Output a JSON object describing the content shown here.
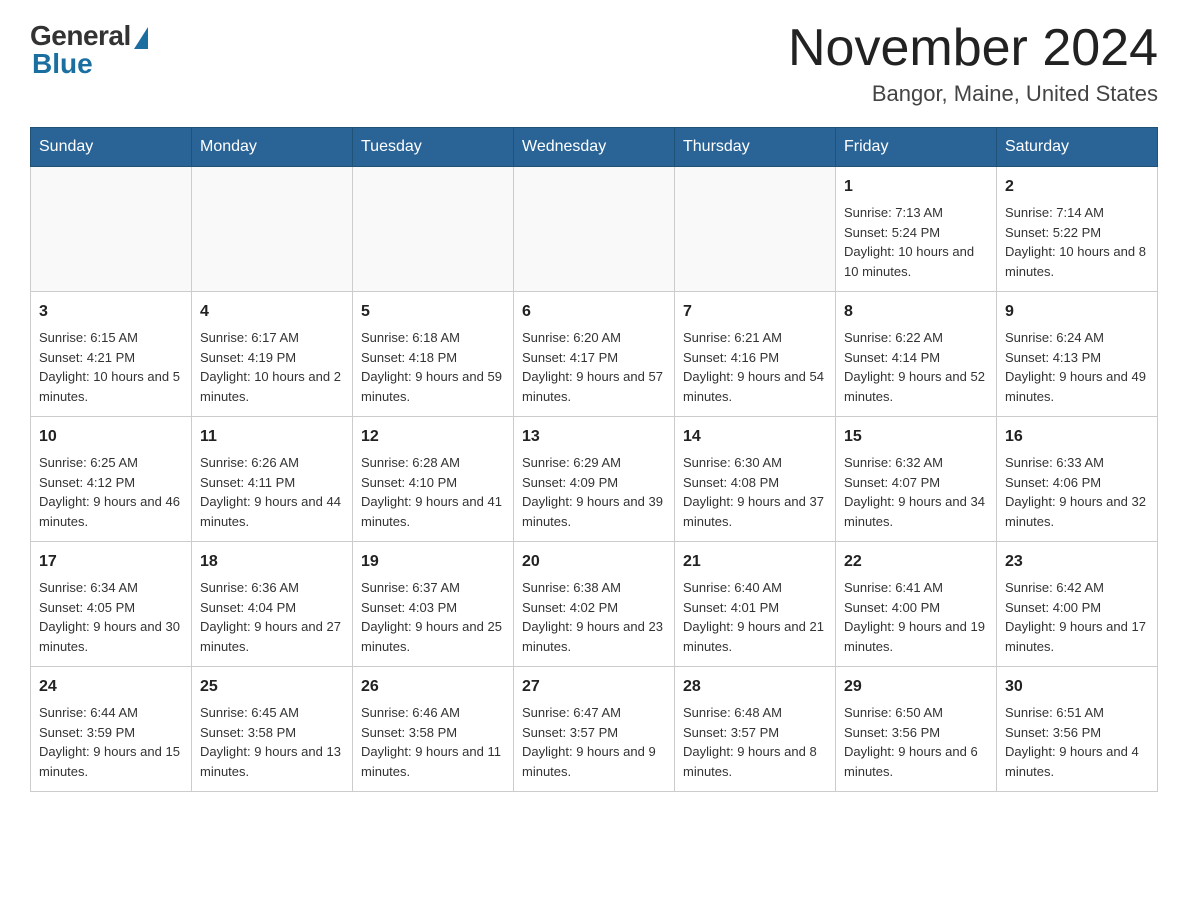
{
  "header": {
    "logo_general": "General",
    "logo_blue": "Blue",
    "month_title": "November 2024",
    "location": "Bangor, Maine, United States"
  },
  "weekdays": [
    "Sunday",
    "Monday",
    "Tuesday",
    "Wednesday",
    "Thursday",
    "Friday",
    "Saturday"
  ],
  "weeks": [
    [
      {
        "day": "",
        "sunrise": "",
        "sunset": "",
        "daylight": ""
      },
      {
        "day": "",
        "sunrise": "",
        "sunset": "",
        "daylight": ""
      },
      {
        "day": "",
        "sunrise": "",
        "sunset": "",
        "daylight": ""
      },
      {
        "day": "",
        "sunrise": "",
        "sunset": "",
        "daylight": ""
      },
      {
        "day": "",
        "sunrise": "",
        "sunset": "",
        "daylight": ""
      },
      {
        "day": "1",
        "sunrise": "Sunrise: 7:13 AM",
        "sunset": "Sunset: 5:24 PM",
        "daylight": "Daylight: 10 hours and 10 minutes."
      },
      {
        "day": "2",
        "sunrise": "Sunrise: 7:14 AM",
        "sunset": "Sunset: 5:22 PM",
        "daylight": "Daylight: 10 hours and 8 minutes."
      }
    ],
    [
      {
        "day": "3",
        "sunrise": "Sunrise: 6:15 AM",
        "sunset": "Sunset: 4:21 PM",
        "daylight": "Daylight: 10 hours and 5 minutes."
      },
      {
        "day": "4",
        "sunrise": "Sunrise: 6:17 AM",
        "sunset": "Sunset: 4:19 PM",
        "daylight": "Daylight: 10 hours and 2 minutes."
      },
      {
        "day": "5",
        "sunrise": "Sunrise: 6:18 AM",
        "sunset": "Sunset: 4:18 PM",
        "daylight": "Daylight: 9 hours and 59 minutes."
      },
      {
        "day": "6",
        "sunrise": "Sunrise: 6:20 AM",
        "sunset": "Sunset: 4:17 PM",
        "daylight": "Daylight: 9 hours and 57 minutes."
      },
      {
        "day": "7",
        "sunrise": "Sunrise: 6:21 AM",
        "sunset": "Sunset: 4:16 PM",
        "daylight": "Daylight: 9 hours and 54 minutes."
      },
      {
        "day": "8",
        "sunrise": "Sunrise: 6:22 AM",
        "sunset": "Sunset: 4:14 PM",
        "daylight": "Daylight: 9 hours and 52 minutes."
      },
      {
        "day": "9",
        "sunrise": "Sunrise: 6:24 AM",
        "sunset": "Sunset: 4:13 PM",
        "daylight": "Daylight: 9 hours and 49 minutes."
      }
    ],
    [
      {
        "day": "10",
        "sunrise": "Sunrise: 6:25 AM",
        "sunset": "Sunset: 4:12 PM",
        "daylight": "Daylight: 9 hours and 46 minutes."
      },
      {
        "day": "11",
        "sunrise": "Sunrise: 6:26 AM",
        "sunset": "Sunset: 4:11 PM",
        "daylight": "Daylight: 9 hours and 44 minutes."
      },
      {
        "day": "12",
        "sunrise": "Sunrise: 6:28 AM",
        "sunset": "Sunset: 4:10 PM",
        "daylight": "Daylight: 9 hours and 41 minutes."
      },
      {
        "day": "13",
        "sunrise": "Sunrise: 6:29 AM",
        "sunset": "Sunset: 4:09 PM",
        "daylight": "Daylight: 9 hours and 39 minutes."
      },
      {
        "day": "14",
        "sunrise": "Sunrise: 6:30 AM",
        "sunset": "Sunset: 4:08 PM",
        "daylight": "Daylight: 9 hours and 37 minutes."
      },
      {
        "day": "15",
        "sunrise": "Sunrise: 6:32 AM",
        "sunset": "Sunset: 4:07 PM",
        "daylight": "Daylight: 9 hours and 34 minutes."
      },
      {
        "day": "16",
        "sunrise": "Sunrise: 6:33 AM",
        "sunset": "Sunset: 4:06 PM",
        "daylight": "Daylight: 9 hours and 32 minutes."
      }
    ],
    [
      {
        "day": "17",
        "sunrise": "Sunrise: 6:34 AM",
        "sunset": "Sunset: 4:05 PM",
        "daylight": "Daylight: 9 hours and 30 minutes."
      },
      {
        "day": "18",
        "sunrise": "Sunrise: 6:36 AM",
        "sunset": "Sunset: 4:04 PM",
        "daylight": "Daylight: 9 hours and 27 minutes."
      },
      {
        "day": "19",
        "sunrise": "Sunrise: 6:37 AM",
        "sunset": "Sunset: 4:03 PM",
        "daylight": "Daylight: 9 hours and 25 minutes."
      },
      {
        "day": "20",
        "sunrise": "Sunrise: 6:38 AM",
        "sunset": "Sunset: 4:02 PM",
        "daylight": "Daylight: 9 hours and 23 minutes."
      },
      {
        "day": "21",
        "sunrise": "Sunrise: 6:40 AM",
        "sunset": "Sunset: 4:01 PM",
        "daylight": "Daylight: 9 hours and 21 minutes."
      },
      {
        "day": "22",
        "sunrise": "Sunrise: 6:41 AM",
        "sunset": "Sunset: 4:00 PM",
        "daylight": "Daylight: 9 hours and 19 minutes."
      },
      {
        "day": "23",
        "sunrise": "Sunrise: 6:42 AM",
        "sunset": "Sunset: 4:00 PM",
        "daylight": "Daylight: 9 hours and 17 minutes."
      }
    ],
    [
      {
        "day": "24",
        "sunrise": "Sunrise: 6:44 AM",
        "sunset": "Sunset: 3:59 PM",
        "daylight": "Daylight: 9 hours and 15 minutes."
      },
      {
        "day": "25",
        "sunrise": "Sunrise: 6:45 AM",
        "sunset": "Sunset: 3:58 PM",
        "daylight": "Daylight: 9 hours and 13 minutes."
      },
      {
        "day": "26",
        "sunrise": "Sunrise: 6:46 AM",
        "sunset": "Sunset: 3:58 PM",
        "daylight": "Daylight: 9 hours and 11 minutes."
      },
      {
        "day": "27",
        "sunrise": "Sunrise: 6:47 AM",
        "sunset": "Sunset: 3:57 PM",
        "daylight": "Daylight: 9 hours and 9 minutes."
      },
      {
        "day": "28",
        "sunrise": "Sunrise: 6:48 AM",
        "sunset": "Sunset: 3:57 PM",
        "daylight": "Daylight: 9 hours and 8 minutes."
      },
      {
        "day": "29",
        "sunrise": "Sunrise: 6:50 AM",
        "sunset": "Sunset: 3:56 PM",
        "daylight": "Daylight: 9 hours and 6 minutes."
      },
      {
        "day": "30",
        "sunrise": "Sunrise: 6:51 AM",
        "sunset": "Sunset: 3:56 PM",
        "daylight": "Daylight: 9 hours and 4 minutes."
      }
    ]
  ]
}
